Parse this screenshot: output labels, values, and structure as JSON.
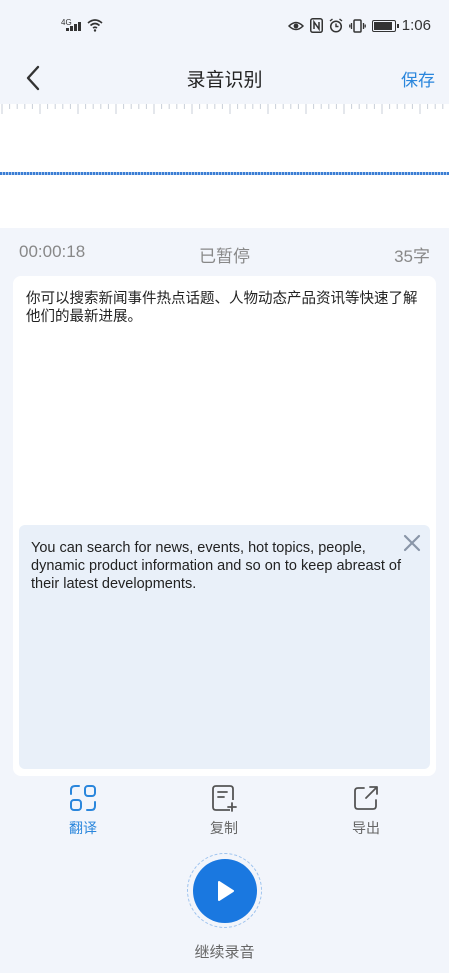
{
  "status_bar": {
    "network": "4G",
    "time": "1:06"
  },
  "nav": {
    "title": "录音识别",
    "save_label": "保存"
  },
  "recording": {
    "elapsed": "00:00:18",
    "state": "已暂停",
    "char_count": "35字"
  },
  "content": {
    "recognized_text": "你可以搜索新闻事件热点话题、人物动态产品资讯等快速了解他们的最新进展。",
    "translation_text": "You can search for news, events, hot topics, people, dynamic product information and so on to keep abreast of their latest developments."
  },
  "actions": [
    {
      "label": "翻译",
      "icon": "translate-icon",
      "active": true
    },
    {
      "label": "复制",
      "icon": "copy-icon",
      "active": false
    },
    {
      "label": "导出",
      "icon": "export-icon",
      "active": false
    }
  ],
  "record": {
    "label": "继续录音",
    "icon": "play-icon"
  },
  "colors": {
    "accent": "#2a86dc",
    "record_button": "#1a78e0",
    "translation_bg": "#e9f0f9",
    "page_bg": "#f2f5fb"
  }
}
